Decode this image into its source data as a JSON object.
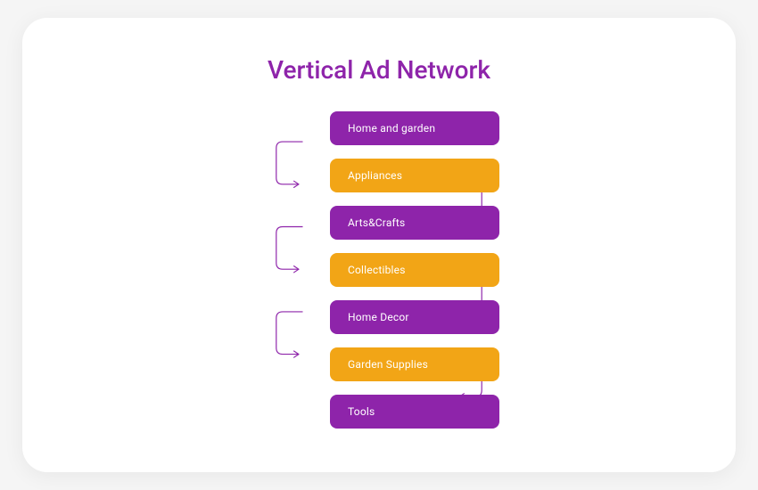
{
  "title": "Vertical Ad Network",
  "colors": {
    "purple": "#8e24aa",
    "orange": "#f2a516"
  },
  "nodes": [
    {
      "label": "Home and garden",
      "color": "purple"
    },
    {
      "label": "Appliances",
      "color": "orange"
    },
    {
      "label": "Arts&Crafts",
      "color": "purple"
    },
    {
      "label": "Collectibles",
      "color": "orange"
    },
    {
      "label": "Home Decor",
      "color": "purple"
    },
    {
      "label": "Garden Supplies",
      "color": "orange"
    },
    {
      "label": "Tools",
      "color": "purple"
    }
  ]
}
